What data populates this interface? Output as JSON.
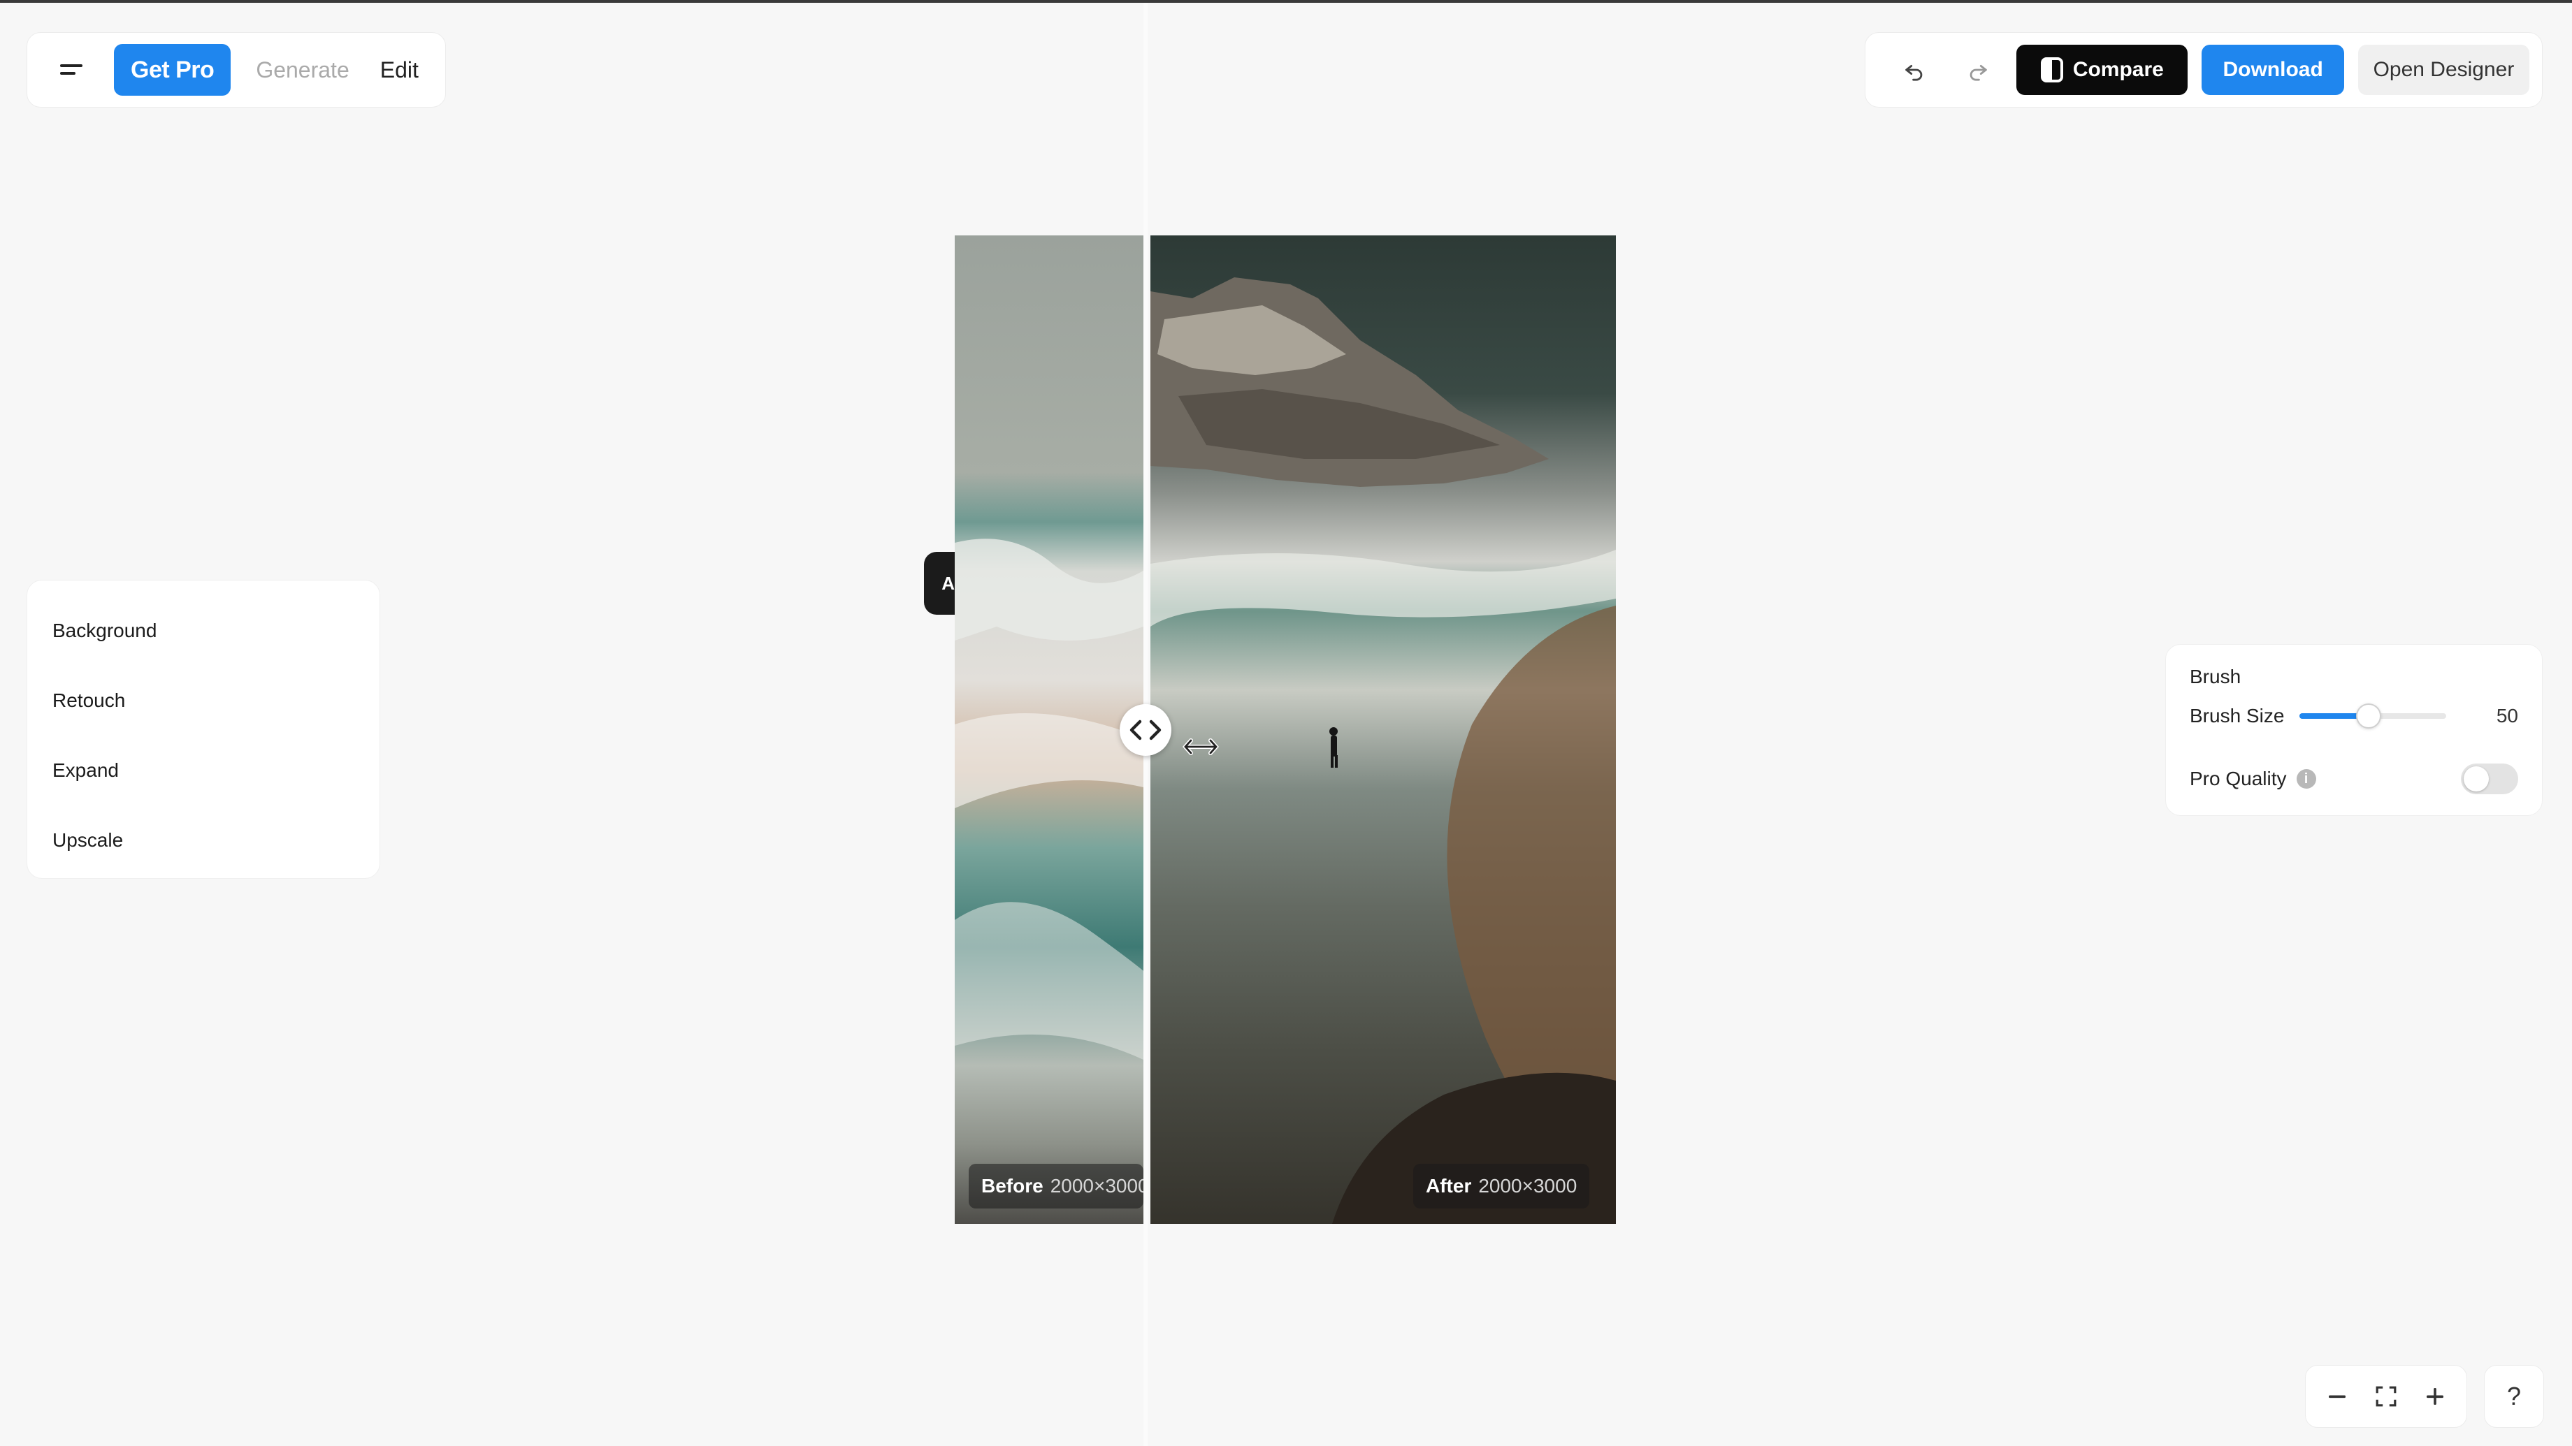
{
  "toolbar_left": {
    "menu_icon": "menu-icon",
    "get_pro_label": "Get Pro",
    "generate_label": "Generate",
    "edit_label": "Edit"
  },
  "toolbar_right": {
    "undo_icon": "undo-icon",
    "redo_icon": "redo-icon",
    "compare_label": "Compare",
    "download_label": "Download",
    "open_designer_label": "Open Designer"
  },
  "left_panel": {
    "items": [
      {
        "label": "Background"
      },
      {
        "label": "Retouch"
      },
      {
        "label": "Expand"
      },
      {
        "label": "Upscale"
      }
    ]
  },
  "canvas": {
    "side_tab_label": "A",
    "before_label": "Before",
    "before_size": "2000×3000",
    "after_label": "After",
    "after_size": "2000×3000"
  },
  "brush_panel": {
    "title": "Brush",
    "brush_size_label": "Brush Size",
    "brush_size_value": "50",
    "brush_size_fraction": 0.47,
    "pro_quality_label": "Pro Quality",
    "pro_quality_enabled": false
  },
  "bottom_controls": {
    "zoom_out_icon": "minus-icon",
    "fit_icon": "fullscreen-icon",
    "zoom_in_icon": "plus-icon",
    "help_label": "?"
  },
  "colors": {
    "accent": "#1f86ee",
    "dark_button": "#0b0b0b",
    "background": "#f7f7f7"
  }
}
